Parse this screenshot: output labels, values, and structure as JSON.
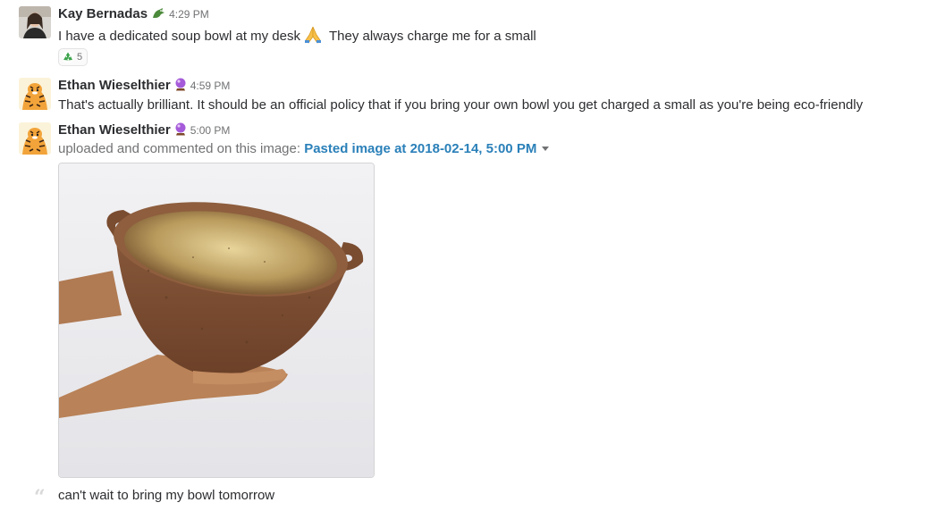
{
  "messages": [
    {
      "author": "Kay Bernadas",
      "status_icon": "dragon-icon",
      "time": "4:29 PM",
      "text_part1": "I have a dedicated soup bowl at my desk",
      "emoji": "folded-hands-icon",
      "text_part2": "They always charge me for a small",
      "reaction": {
        "icon": "recycle-icon",
        "count": "5"
      }
    },
    {
      "author": "Ethan Wieselthier",
      "status_icon": "crystal-ball-icon",
      "time": "4:59 PM",
      "text": "That's actually brilliant. It should be an official policy that if you bring your own bowl you get charged a small as you're being eco-friendly"
    },
    {
      "author": "Ethan Wieselthier",
      "status_icon": "crystal-ball-icon",
      "time": "5:00 PM",
      "upload_prefix": "uploaded and commented on this image:",
      "file_name": "Pasted image at 2018-02-14, 5:00 PM",
      "comment": "can't wait to bring my bowl tomorrow"
    }
  ],
  "colors": {
    "link": "#2a80b9",
    "text": "#2c2d30",
    "muted": "#717274"
  }
}
